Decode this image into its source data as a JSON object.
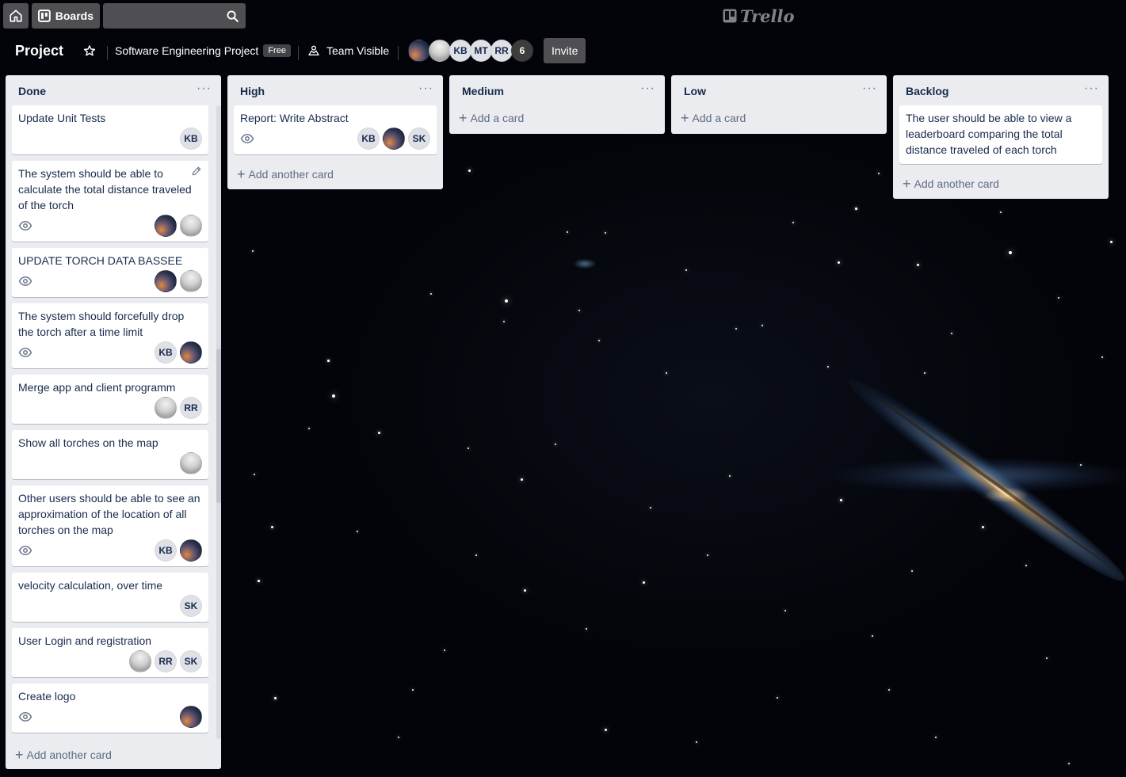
{
  "topbar": {
    "boards_label": "Boards",
    "search_placeholder": "",
    "logo_text": "Trello"
  },
  "board": {
    "title": "Project",
    "team_name": "Software Engineering Project",
    "plan_badge": "Free",
    "visibility": "Team Visible",
    "members": [
      {
        "initials": "",
        "avatar": "space"
      },
      {
        "initials": "",
        "avatar": "grey"
      },
      {
        "initials": "KB"
      },
      {
        "initials": "MT"
      },
      {
        "initials": "RR"
      }
    ],
    "member_count": "6",
    "invite_label": "Invite"
  },
  "lists": {
    "done": {
      "title": "Done",
      "add_label": "Add another card",
      "cards": [
        {
          "title": "Update Unit Tests",
          "watch": false,
          "members": [
            "KB"
          ]
        },
        {
          "title": "The system should be able to calculate the total distance traveled of the torch",
          "watch": true,
          "members": [
            "space",
            "grey"
          ]
        },
        {
          "title": "UPDATE TORCH DATA BASSEE",
          "watch": true,
          "members": [
            "space",
            "grey"
          ]
        },
        {
          "title": "The system should forcefully drop the torch after a time limit",
          "watch": true,
          "members": [
            "KB",
            "space"
          ]
        },
        {
          "title": "Merge app and client programm",
          "watch": false,
          "members": [
            "grey",
            "RR"
          ]
        },
        {
          "title": "Show all torches on the map",
          "watch": false,
          "members": [
            "grey"
          ]
        },
        {
          "title": "Other users should be able to see an approximation of the location of all torches on the map",
          "watch": true,
          "members": [
            "KB",
            "space"
          ]
        },
        {
          "title": "velocity calculation, over time",
          "watch": false,
          "members": [
            "SK"
          ]
        },
        {
          "title": "User Login and registration",
          "watch": false,
          "members": [
            "grey",
            "RR",
            "SK"
          ]
        },
        {
          "title": "Create logo",
          "watch": true,
          "members": [
            "space"
          ]
        }
      ]
    },
    "high": {
      "title": "High",
      "add_label": "Add another card",
      "cards": [
        {
          "title": "Report: Write Abstract",
          "watch": true,
          "members": [
            "KB",
            "space",
            "SK"
          ]
        }
      ]
    },
    "medium": {
      "title": "Medium",
      "add_label": "Add a card"
    },
    "low": {
      "title": "Low",
      "add_label": "Add a card"
    },
    "backlog": {
      "title": "Backlog",
      "add_label": "Add another card",
      "cards": [
        {
          "title": "The user should be able to view a leaderboard comparing the total distance traveled of each torch"
        }
      ]
    }
  },
  "colors": {
    "list_bg": "#ebecf0",
    "card_bg": "#ffffff",
    "text": "#172b4d",
    "muted": "#5e6c84"
  }
}
